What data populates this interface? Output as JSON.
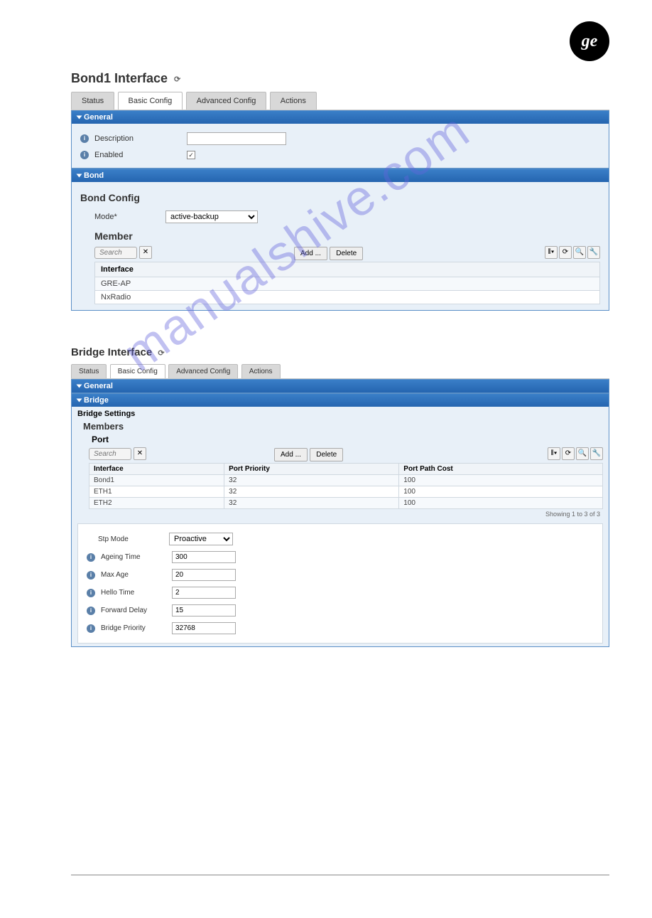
{
  "watermark": "manualshive.com",
  "section1": {
    "title": "Bond1 Interface",
    "tabs": [
      "Status",
      "Basic Config",
      "Advanced Config",
      "Actions"
    ],
    "active_tab": 1,
    "panels": {
      "general": {
        "header": "General",
        "description_label": "Description",
        "description_value": "",
        "enabled_label": "Enabled",
        "enabled_checked": true
      },
      "bond": {
        "header": "Bond",
        "config_title": "Bond Config",
        "mode_label": "Mode*",
        "mode_value": "active-backup",
        "member_title": "Member",
        "search_placeholder": "Search",
        "add_btn": "Add ...",
        "delete_btn": "Delete",
        "col_interface": "Interface",
        "rows": [
          "GRE-AP",
          "NxRadio"
        ]
      }
    }
  },
  "section2": {
    "title": "Bridge Interface",
    "tabs": [
      "Status",
      "Basic Config",
      "Advanced Config",
      "Actions"
    ],
    "active_tab": 1,
    "panels": {
      "general": {
        "header": "General"
      },
      "bridge": {
        "header": "Bridge",
        "settings_title": "Bridge Settings",
        "members_title": "Members",
        "port_title": "Port",
        "search_placeholder": "Search",
        "add_btn": "Add ...",
        "delete_btn": "Delete",
        "columns": [
          "Interface",
          "Port Priority",
          "Port Path Cost"
        ],
        "rows": [
          {
            "iface": "Bond1",
            "priority": "32",
            "cost": "100"
          },
          {
            "iface": "ETH1",
            "priority": "32",
            "cost": "100"
          },
          {
            "iface": "ETH2",
            "priority": "32",
            "cost": "100"
          }
        ],
        "showing": "Showing 1 to 3 of 3",
        "stp_mode_label": "Stp Mode",
        "stp_mode_value": "Proactive",
        "ageing_label": "Ageing Time",
        "ageing_value": "300",
        "maxage_label": "Max Age",
        "maxage_value": "20",
        "hello_label": "Hello Time",
        "hello_value": "2",
        "fwd_label": "Forward Delay",
        "fwd_value": "15",
        "prio_label": "Bridge Priority",
        "prio_value": "32768"
      }
    }
  }
}
